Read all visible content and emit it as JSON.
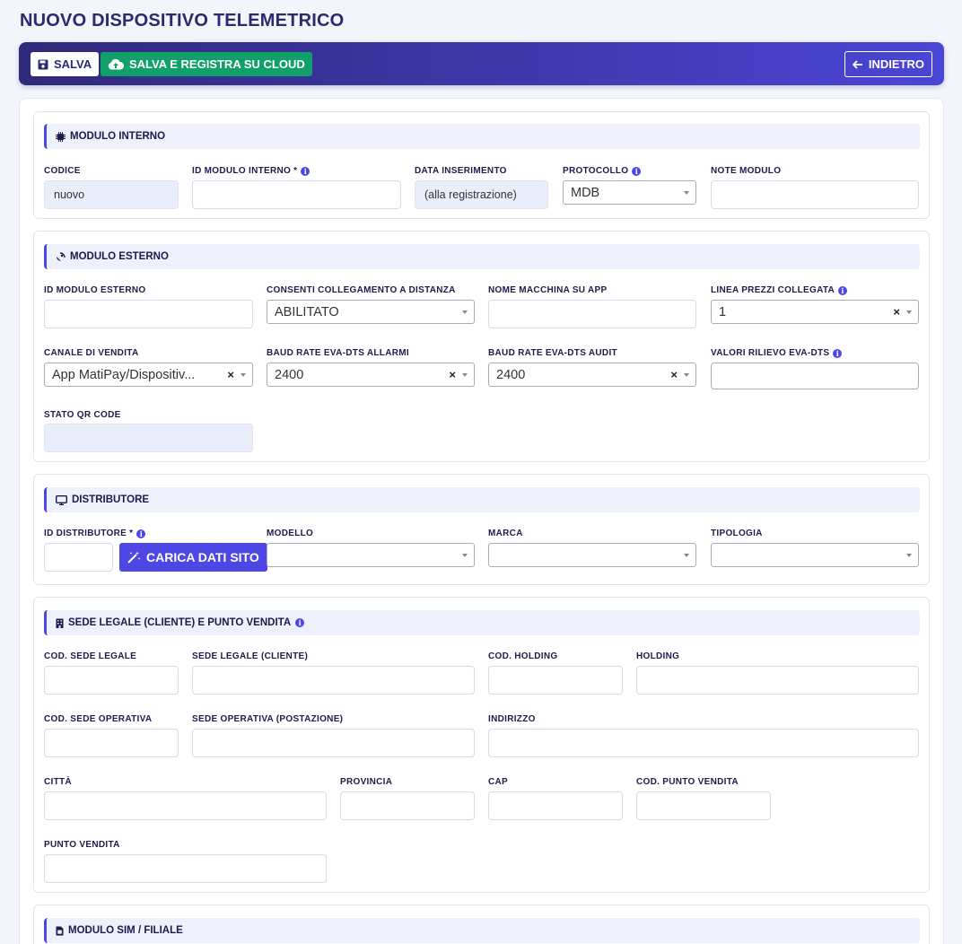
{
  "page": {
    "title": "NUOVO DISPOSITIVO TELEMETRICO"
  },
  "toolbar": {
    "save_label": "SALVA",
    "save_cloud_label": "SALVA E REGISTRA SU CLOUD",
    "back_label": "INDIETRO"
  },
  "sections": {
    "internal": {
      "title": "MODULO INTERNO",
      "fields": {
        "code": {
          "label": "CODICE",
          "value": "nuovo"
        },
        "internal_id": {
          "label": "ID MODULO INTERNO *",
          "value": ""
        },
        "insert_date": {
          "label": "DATA INSERIMENTO",
          "value": "(alla registrazione)"
        },
        "protocol": {
          "label": "PROTOCOLLO",
          "value": "MDB"
        },
        "notes": {
          "label": "NOTE MODULO",
          "value": ""
        }
      }
    },
    "external": {
      "title": "MODULO ESTERNO",
      "fields": {
        "external_id": {
          "label": "ID MODULO ESTERNO",
          "value": ""
        },
        "remote": {
          "label": "CONSENTI COLLEGAMENTO A DISTANZA",
          "value": "ABILITATO"
        },
        "machine_name": {
          "label": "NOME MACCHINA SU APP",
          "value": ""
        },
        "price_line": {
          "label": "LINEA PREZZI COLLEGATA",
          "value": "1"
        },
        "sales_channel": {
          "label": "CANALE DI VENDITA",
          "value": "App MatiPay/Dispositiv..."
        },
        "baud_alarms": {
          "label": "BAUD RATE EVA-DTS ALLARMI",
          "value": "2400"
        },
        "baud_audit": {
          "label": "BAUD RATE EVA-DTS AUDIT",
          "value": "2400"
        },
        "eva_values": {
          "label": "VALORI RILIEVO EVA-DTS",
          "value": ""
        },
        "qr_state": {
          "label": "STATO QR CODE",
          "value": ""
        }
      }
    },
    "distributor": {
      "title": "DISTRIBUTORE",
      "load_button": "CARICA DATI SITO",
      "fields": {
        "dist_id": {
          "label": "ID DISTRIBUTORE *",
          "value": ""
        },
        "model": {
          "label": "MODELLO",
          "value": ""
        },
        "brand": {
          "label": "MARCA",
          "value": ""
        },
        "type": {
          "label": "TIPOLOGIA",
          "value": ""
        }
      }
    },
    "legal": {
      "title": "SEDE LEGALE (CLIENTE) E PUNTO VENDITA",
      "fields": {
        "legal_code": {
          "label": "COD. SEDE LEGALE",
          "value": ""
        },
        "legal_name": {
          "label": "SEDE LEGALE (CLIENTE)",
          "value": ""
        },
        "holding_code": {
          "label": "COD. HOLDING",
          "value": ""
        },
        "holding": {
          "label": "HOLDING",
          "value": ""
        },
        "op_code": {
          "label": "COD. SEDE OPERATIVA",
          "value": ""
        },
        "op_name": {
          "label": "SEDE OPERATIVA (POSTAZIONE)",
          "value": ""
        },
        "address": {
          "label": "INDIRIZZO",
          "value": ""
        },
        "city": {
          "label": "CITTÀ",
          "value": ""
        },
        "province": {
          "label": "PROVINCIA",
          "value": ""
        },
        "cap": {
          "label": "CAP",
          "value": ""
        },
        "pos_code": {
          "label": "COD. PUNTO VENDITA",
          "value": ""
        },
        "pos": {
          "label": "PUNTO VENDITA",
          "value": ""
        }
      }
    },
    "sim": {
      "title": "MODULO SIM / FILIALE"
    }
  },
  "colors": {
    "accent": "#4e46e5",
    "success": "#12a06a",
    "header_dark": "#2f2a7a"
  }
}
